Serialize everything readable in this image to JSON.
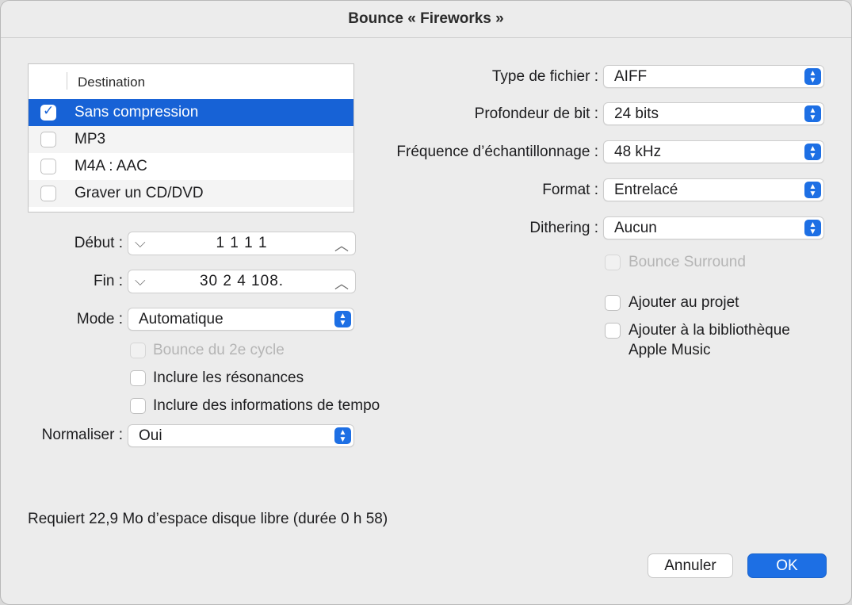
{
  "window": {
    "title": "Bounce « Fireworks »"
  },
  "destination": {
    "header": "Destination",
    "items": [
      {
        "label": "Sans compression",
        "checked": true,
        "selected": true
      },
      {
        "label": "MP3",
        "checked": false
      },
      {
        "label": "M4A : AAC",
        "checked": false
      },
      {
        "label": "Graver un CD/DVD",
        "checked": false
      }
    ]
  },
  "range": {
    "start_label": "Début :",
    "start_value": "1 1 1     1",
    "end_label": "Fin :",
    "end_value": "30  2  4  108."
  },
  "mode": {
    "label": "Mode :",
    "value": "Automatique"
  },
  "options_left": {
    "bounce_cycle": "Bounce du 2e cycle",
    "include_tails": "Inclure les résonances",
    "include_tempo": "Inclure des informations de tempo"
  },
  "normalize": {
    "label": "Normaliser :",
    "value": "Oui"
  },
  "settings": {
    "file_type_label": "Type de fichier :",
    "file_type_value": "AIFF",
    "bit_depth_label": "Profondeur de bit :",
    "bit_depth_value": "24 bits",
    "sample_rate_label": "Fréquence d’échantillonnage :",
    "sample_rate_value": "48 kHz",
    "format_label": "Format :",
    "format_value": "Entrelacé",
    "dithering_label": "Dithering :",
    "dithering_value": "Aucun"
  },
  "options_right": {
    "bounce_surround": "Bounce Surround",
    "add_to_project": "Ajouter au projet",
    "add_to_library_line1": "Ajouter à la bibliothèque",
    "add_to_library_line2": "Apple Music"
  },
  "status": {
    "text": "Requiert 22,9 Mo d’espace disque libre (durée 0 h 58)"
  },
  "buttons": {
    "cancel": "Annuler",
    "ok": "OK"
  },
  "colors": {
    "accent": "#1d6fe4",
    "selection": "#1762d6"
  }
}
